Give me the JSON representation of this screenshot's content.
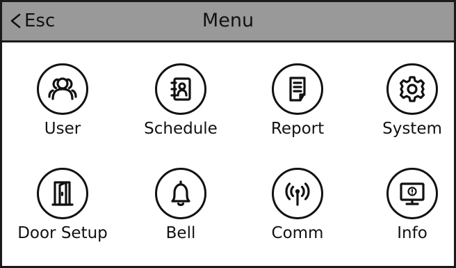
{
  "header": {
    "back_label": "Esc",
    "title": "Menu"
  },
  "menu": {
    "items": [
      {
        "label": "User",
        "icon": "users-icon"
      },
      {
        "label": "Schedule",
        "icon": "contact-book-icon"
      },
      {
        "label": "Report",
        "icon": "document-icon"
      },
      {
        "label": "System",
        "icon": "gear-icon"
      },
      {
        "label": "Door Setup",
        "icon": "door-icon"
      },
      {
        "label": "Bell",
        "icon": "bell-icon"
      },
      {
        "label": "Comm",
        "icon": "antenna-icon"
      },
      {
        "label": "Info",
        "icon": "monitor-info-icon"
      }
    ]
  },
  "colors": {
    "header_background": "#999999",
    "border": "#1a1a1a",
    "foreground": "#111111",
    "background": "#ffffff"
  }
}
